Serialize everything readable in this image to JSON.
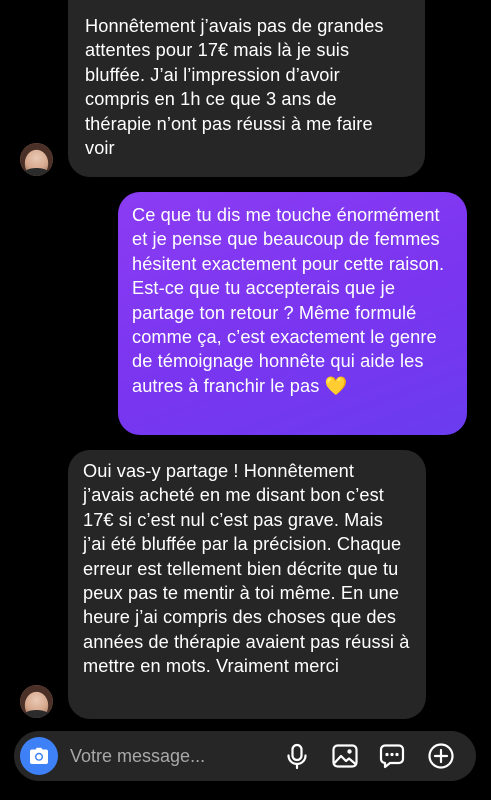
{
  "conversation": {
    "messages": [
      {
        "direction": "incoming",
        "text": "Honnêtement j’avais pas de grandes attentes pour 17€ mais là je suis bluffée. J’ai l’impression d’avoir compris en 1h ce que 3 ans de thérapie n’ont pas réussi à me faire voir"
      },
      {
        "direction": "outgoing",
        "text": "Ce que tu dis me touche énormément et je pense que beaucoup de femmes hésitent exactement pour cette raison. Est-ce que tu accepterais que je partage ton retour ? Même formulé comme ça, c’est exactement le genre de témoignage honnête qui aide les autres à franchir le pas 💛"
      },
      {
        "direction": "incoming",
        "text": "Oui vas-y partage ! Honnêtement j’avais acheté en me disant bon c’est 17€ si c’est nul c’est pas grave. Mais j’ai été bluffée par la précision. Chaque erreur est tellement bien décrite que tu peux pas te mentir à toi même. En une heure j’ai compris des choses que des années de thérapie avaient pas réussi à mettre en mots. Vraiment merci"
      }
    ]
  },
  "composer": {
    "placeholder": "Votre message...",
    "value": ""
  },
  "icons": {
    "camera": "camera-icon",
    "mic": "microphone-icon",
    "gallery": "image-gallery-icon",
    "sticker": "sticker-chat-icon",
    "add": "plus-circle-icon"
  },
  "colors": {
    "background": "#000000",
    "incoming_bubble": "#262626",
    "outgoing_bubble_start": "#8b3cf3",
    "outgoing_bubble_end": "#6a3cf0",
    "camera_button": "#3e80f6",
    "placeholder": "#a8a8a8"
  }
}
